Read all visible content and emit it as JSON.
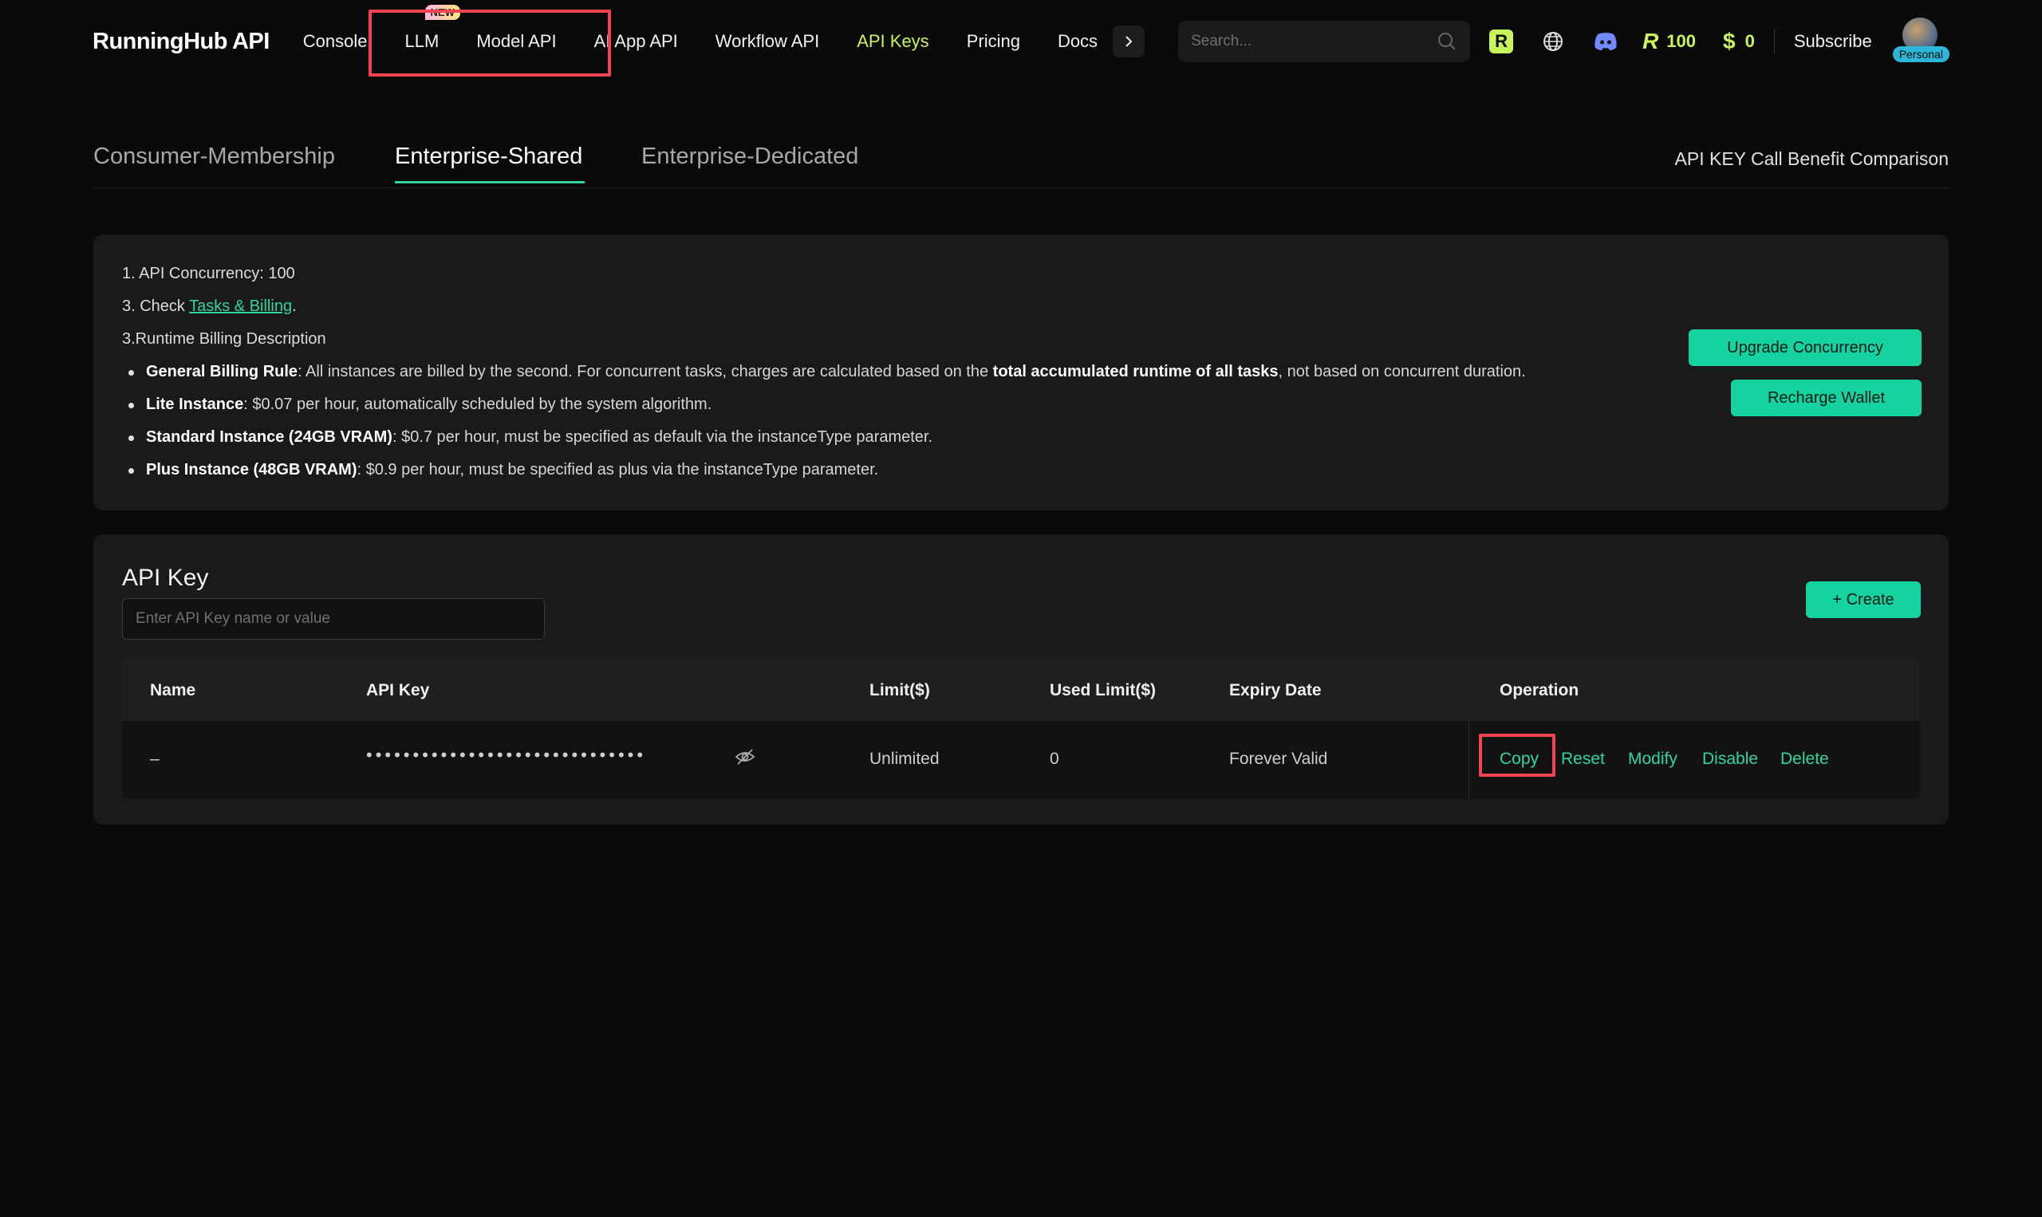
{
  "nav": {
    "logo": "RunningHub",
    "logo_suffix": "API",
    "links": [
      {
        "label": "Console"
      },
      {
        "label": "LLM",
        "badge": "NEW"
      },
      {
        "label": "Model API"
      },
      {
        "label": "AI App API"
      },
      {
        "label": "Workflow API"
      },
      {
        "label": "API Keys",
        "active": true
      },
      {
        "label": "Pricing"
      },
      {
        "label": "Docs"
      }
    ],
    "search_placeholder": "Search...",
    "r_logo": "R",
    "credits_symbol": "R",
    "credits": "100",
    "balance_symbol": "$",
    "balance": "0",
    "subscribe": "Subscribe",
    "avatar_badge": "Personal"
  },
  "tabs": {
    "items": [
      "Consumer-Membership",
      "Enterprise-Shared",
      "Enterprise-Dedicated"
    ],
    "active_index": 1,
    "compare_link": "API KEY Call Benefit Comparison"
  },
  "info": {
    "line1": "1. API Concurrency: 100",
    "line2_prefix": "3. Check ",
    "line2_link": "Tasks & Billing",
    "line2_suffix": ".",
    "line3": "3.Runtime Billing Description",
    "bullets": [
      {
        "bold": "General Billing Rule",
        "text": ": All instances are billed by the second. For concurrent tasks, charges are calculated based on the ",
        "bold2": "total accumulated runtime of all tasks",
        "text2": ", not based on concurrent duration."
      },
      {
        "bold": "Lite Instance",
        "text": ": $0.07 per hour, automatically scheduled by the system algorithm."
      },
      {
        "bold": "Standard Instance (24GB VRAM)",
        "text": ": $0.7 per hour, must be specified as default via the instanceType parameter."
      },
      {
        "bold": "Plus Instance (48GB VRAM)",
        "text": ": $0.9 per hour, must be specified as plus via the instanceType parameter."
      }
    ],
    "upgrade_button": "Upgrade Concurrency",
    "recharge_button": "Recharge Wallet"
  },
  "apikey": {
    "title": "API Key",
    "search_placeholder": "Enter API Key name or value",
    "create_button": "+ Create",
    "columns": [
      "Name",
      "API Key",
      "Limit($)",
      "Used Limit($)",
      "Expiry Date",
      "Operation"
    ],
    "rows": [
      {
        "name": "–",
        "key_masked": "••••••••••••••••••••••••••••••",
        "limit": "Unlimited",
        "used": "0",
        "expiry": "Forever Valid",
        "ops": [
          "Copy",
          "Reset",
          "Modify",
          "Disable",
          "Delete"
        ]
      }
    ]
  },
  "colors": {
    "accent": "#2fd6a3",
    "nav_active": "#c8f55a",
    "highlight": "#f04452",
    "button": "#14d3a0"
  }
}
